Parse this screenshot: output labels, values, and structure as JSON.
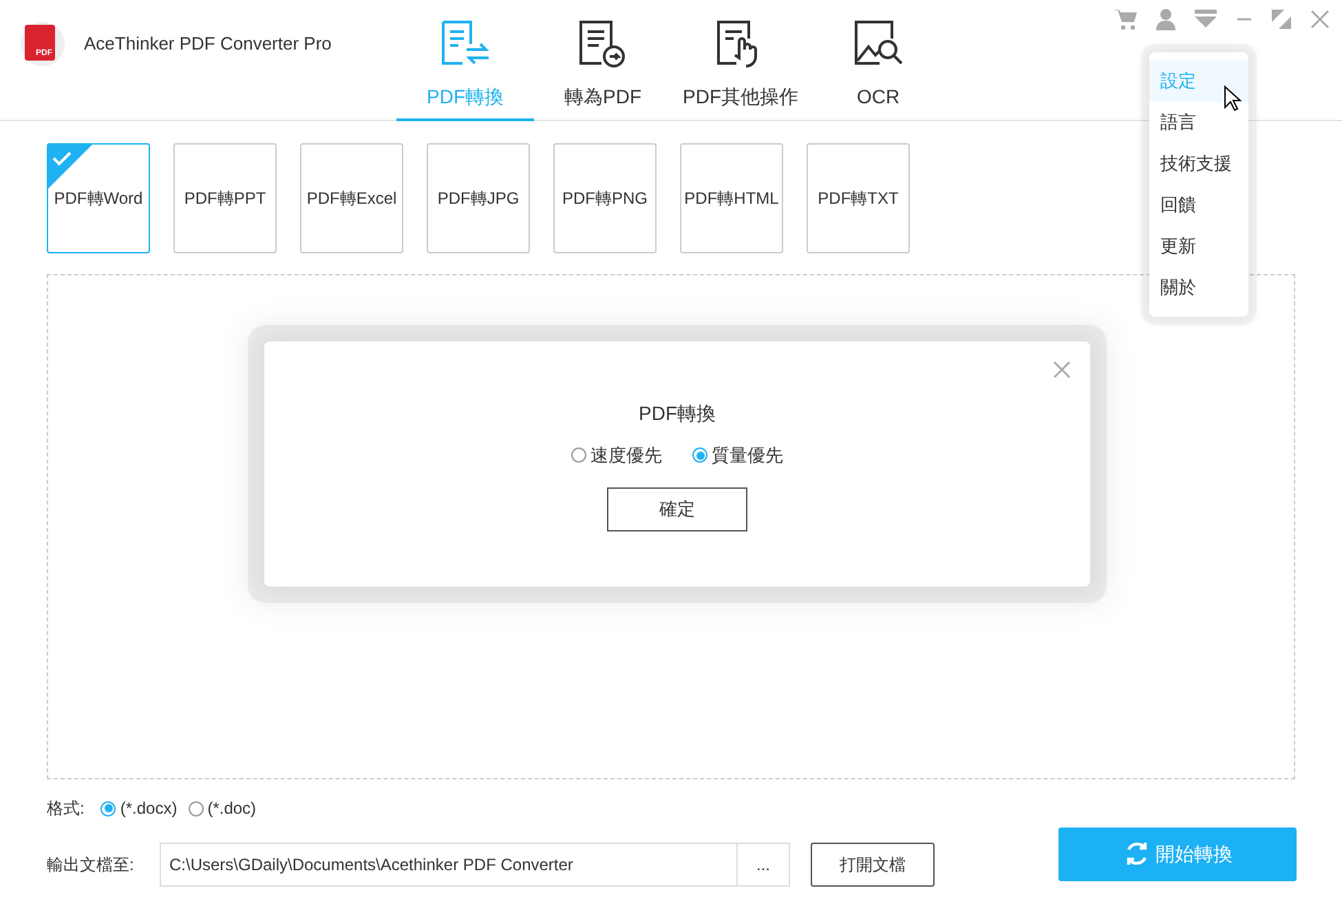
{
  "app": {
    "title": "AceThinker PDF Converter Pro",
    "logo_text": "PDF"
  },
  "tabs": [
    {
      "label": "PDF轉換",
      "kind": "convert",
      "selected": true
    },
    {
      "label": "轉為PDF",
      "kind": "topdf",
      "selected": false
    },
    {
      "label": "PDF其他操作",
      "kind": "touch",
      "selected": false
    },
    {
      "label": "OCR",
      "kind": "ocr",
      "selected": false
    }
  ],
  "formats": [
    {
      "label": "PDF轉Word",
      "selected": true
    },
    {
      "label": "PDF轉PPT",
      "selected": false
    },
    {
      "label": "PDF轉Excel",
      "selected": false
    },
    {
      "label": "PDF轉JPG",
      "selected": false
    },
    {
      "label": "PDF轉PNG",
      "selected": false
    },
    {
      "label": "PDF轉HTML",
      "selected": false
    },
    {
      "label": "PDF轉TXT",
      "selected": false
    }
  ],
  "menu": {
    "items": [
      {
        "label": "設定",
        "selected": true
      },
      {
        "label": "語言",
        "selected": false
      },
      {
        "label": "技術支援",
        "selected": false
      },
      {
        "label": "回饋",
        "selected": false
      },
      {
        "label": "更新",
        "selected": false
      },
      {
        "label": "關於",
        "selected": false
      }
    ]
  },
  "dialog": {
    "title": "PDF轉換",
    "options": [
      {
        "label": "速度優先",
        "selected": false
      },
      {
        "label": "質量優先",
        "selected": true
      }
    ],
    "button": "確定"
  },
  "format": {
    "label": "格式:",
    "options": [
      {
        "label": "(*.docx)",
        "selected": true
      },
      {
        "label": "(*.doc)",
        "selected": false
      }
    ]
  },
  "output": {
    "label": "輸出文檔至:",
    "path": "C:\\Users\\GDaily\\Documents\\Acethinker PDF Converter",
    "browse": "...",
    "open_button": "打開文檔"
  },
  "start_button": "開始轉換"
}
